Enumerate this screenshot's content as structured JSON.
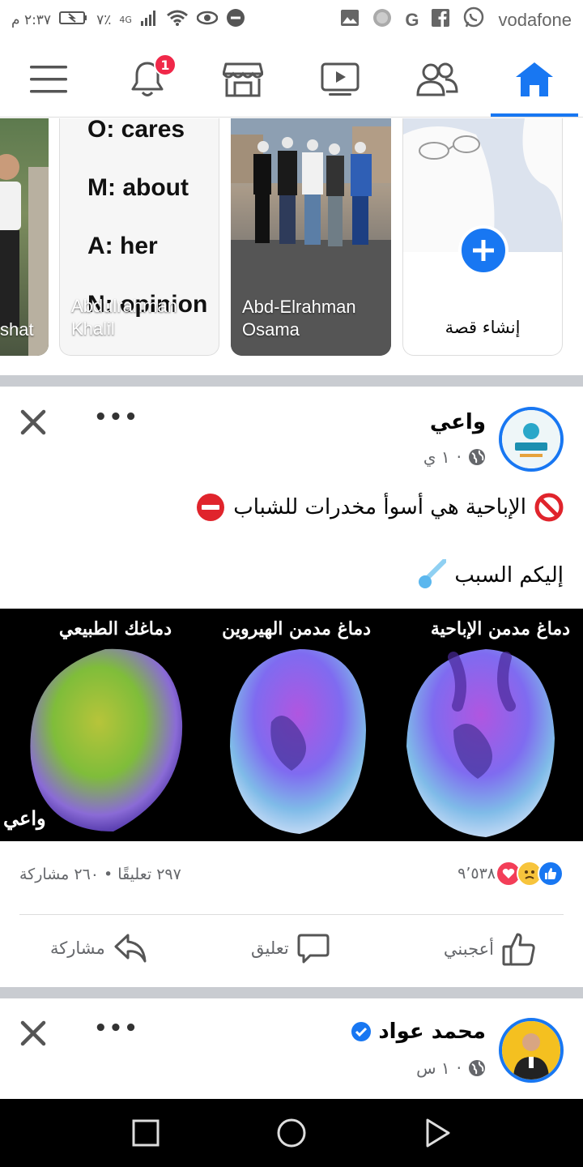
{
  "status_bar": {
    "time": "٢:٣٧ م",
    "battery": "٧٪",
    "network": "4G",
    "carrier": "vodafone",
    "left_icons": [
      "gallery-icon",
      "circle-icon",
      "google-icon",
      "facebook-icon",
      "whatsapp-icon"
    ],
    "right_icons": [
      "battery-icon",
      "signal-icon",
      "wifi-icon",
      "eye-icon",
      "minus-circle-icon"
    ]
  },
  "nav": {
    "notifications_badge": "1",
    "items": [
      "menu-icon",
      "bell-icon",
      "marketplace-icon",
      "video-icon",
      "friends-icon",
      "home-icon"
    ],
    "active": "home",
    "accent": "#1877f2"
  },
  "stories": {
    "items": [
      {
        "name": "shat"
      },
      {
        "name": "Abdulrahman Khalil",
        "line1": "Abdulrahman",
        "line2": "Khalil",
        "lines": [
          "O: cares",
          "M: about",
          "A:  her",
          "N: opinion"
        ]
      },
      {
        "name": "Abd-Elrahman Osama",
        "line1": "Abd-Elrahman",
        "line2": "Osama"
      }
    ],
    "create_label": "إنشاء قصة"
  },
  "post1": {
    "author": "واعي",
    "time": "١ ي",
    "text_line1": "الإباحية هي أسوأ مخدرات للشباب",
    "text_line2": "إليكم السبب",
    "image_labels": [
      "دماغ مدمن الإباحية",
      "دماغ مدمن الهيروين",
      "دماغك الطبيعي"
    ],
    "watermark": "واعي",
    "reactions_count": "٩٬٥٣٨",
    "comments_shares": "٢٩٧ تعليقًا • ٢٦٠ مشاركة",
    "like_label": "أعجبني",
    "comment_label": "تعليق",
    "share_label": "مشاركة"
  },
  "post2": {
    "author": "محمد عواد",
    "time": "١ س",
    "verified": true
  },
  "colors": {
    "brand": "#1877f2",
    "badge": "#f02849",
    "muted": "#65676b"
  }
}
